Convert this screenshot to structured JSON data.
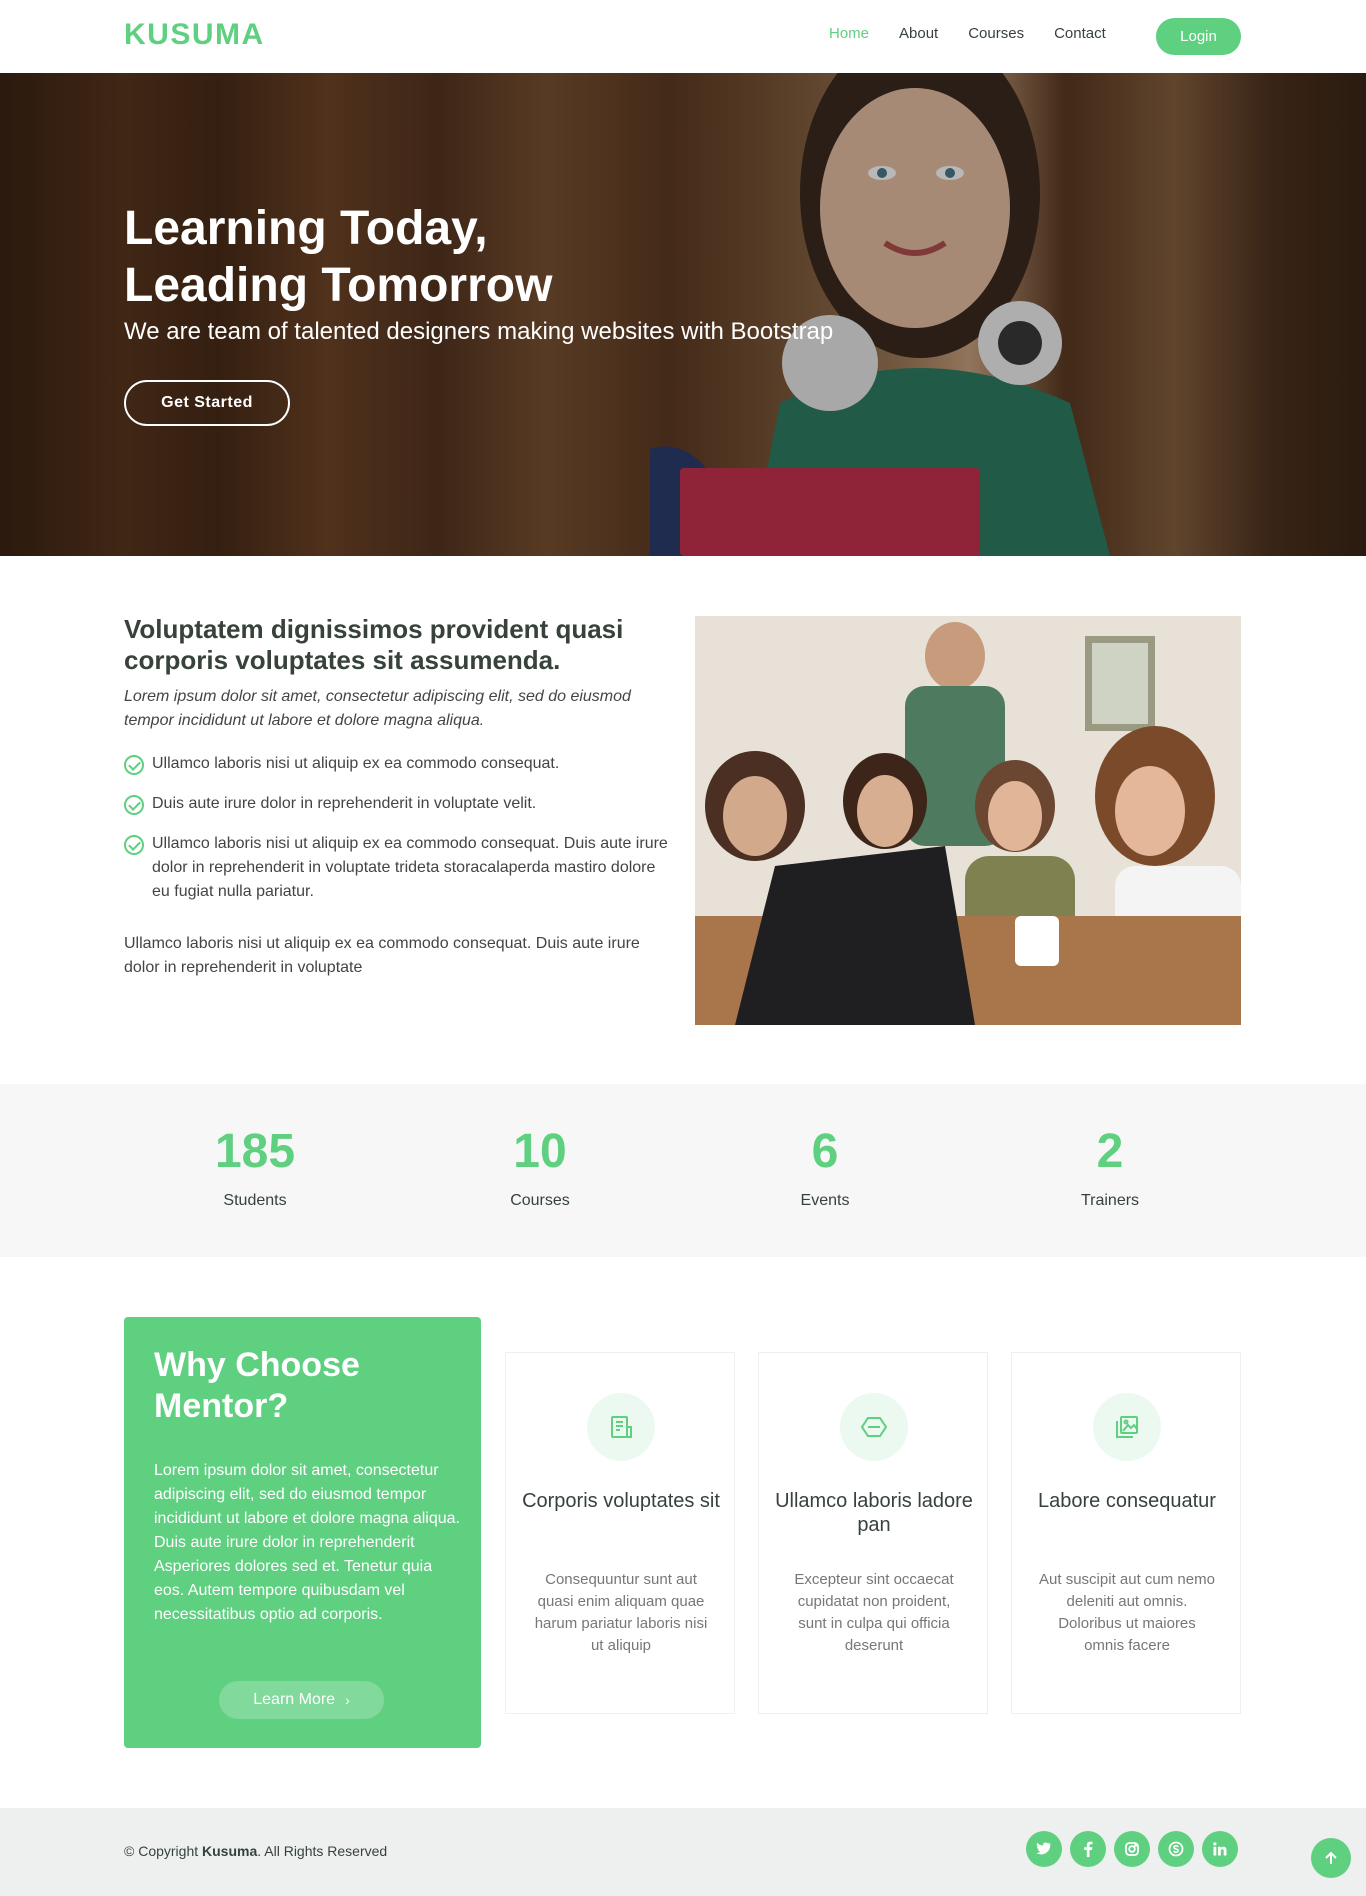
{
  "header": {
    "logo": "KUSUMA",
    "nav": [
      "Home",
      "About",
      "Courses",
      "Contact"
    ],
    "login_label": "Login"
  },
  "hero": {
    "title_line1": "Learning Today,",
    "title_line2": "Leading Tomorrow",
    "subtitle": "We are team of talented designers making websites with Bootstrap",
    "cta_label": "Get Started"
  },
  "about": {
    "title": "Voluptatem dignissimos provident quasi corporis voluptates sit assumenda.",
    "lead": "Lorem ipsum dolor sit amet, consectetur adipiscing elit, sed do eiusmod tempor incididunt ut labore et dolore magna aliqua.",
    "items": [
      "Ullamco laboris nisi ut aliquip ex ea commodo consequat.",
      "Duis aute irure dolor in reprehenderit in voluptate velit.",
      "Ullamco laboris nisi ut aliquip ex ea commodo consequat. Duis aute irure dolor in reprehenderit in voluptate trideta storacalaperda mastiro dolore eu fugiat nulla pariatur."
    ],
    "paragraph": "Ullamco laboris nisi ut aliquip ex ea commodo consequat. Duis aute irure dolor in reprehenderit in voluptate"
  },
  "counts": [
    {
      "value": "185",
      "label": "Students"
    },
    {
      "value": "10",
      "label": "Courses"
    },
    {
      "value": "6",
      "label": "Events"
    },
    {
      "value": "2",
      "label": "Trainers"
    }
  ],
  "why": {
    "title": "Why Choose Mentor?",
    "text": "Lorem ipsum dolor sit amet, consectetur adipiscing elit, sed do eiusmod tempor incididunt ut labore et dolore magna aliqua. Duis aute irure dolor in reprehenderit Asperiores dolores sed et. Tenetur quia eos. Autem tempore quibusdam vel necessitatibus optio ad corporis.",
    "button_label": "Learn More",
    "cards": [
      {
        "icon": "receipt-icon",
        "title": "Corporis voluptates sit",
        "text": "Consequuntur sunt aut quasi enim aliquam quae harum pariatur laboris nisi ut aliquip"
      },
      {
        "icon": "cube-alt-icon",
        "title": "Ullamco laboris ladore pan",
        "text": "Excepteur sint occaecat cupidatat non proident, sunt in culpa qui officia deserunt"
      },
      {
        "icon": "images-icon",
        "title": "Labore consequatur",
        "text": "Aut suscipit aut cum nemo deleniti aut omnis. Doloribus ut maiores omnis facere"
      }
    ]
  },
  "footer": {
    "copyright_prefix": "© Copyright",
    "brand": "Kusuma",
    "copyright_suffix": ". All Rights Reserved",
    "socials": [
      "twitter-icon",
      "facebook-icon",
      "instagram-icon",
      "skype-icon",
      "linkedin-icon"
    ]
  },
  "colors": {
    "accent": "#5fcf80",
    "heading": "#37423b",
    "muted_bg": "#f6f7f6"
  }
}
